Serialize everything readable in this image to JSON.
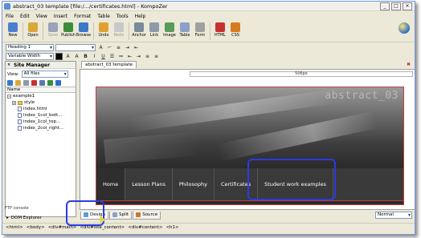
{
  "window": {
    "title": "abstract_03 template [file:/.../certificates.html] - KompoZer"
  },
  "menu": [
    "File",
    "Edit",
    "View",
    "Insert",
    "Format",
    "Table",
    "Tools",
    "Help"
  ],
  "toolbar": {
    "buttons": [
      {
        "label": "New",
        "icon": "new-icon",
        "color": "#4a7fd0"
      },
      {
        "label": "Open",
        "icon": "open-icon",
        "color": "#d8a93a"
      },
      {
        "label": "Save",
        "icon": "save-icon",
        "color": "#9aa3b8"
      },
      {
        "label": "Publish",
        "icon": "publish-icon",
        "color": "#3c8c3c"
      },
      {
        "label": "Browse",
        "icon": "browse-icon",
        "color": "#3a7ac8"
      },
      {
        "label": "Undo",
        "icon": "undo-icon",
        "color": "#e0a030"
      },
      {
        "label": "Redo",
        "icon": "redo-icon",
        "color": "#c8c8c8"
      },
      {
        "label": "Anchor",
        "icon": "anchor-icon",
        "color": "#7a8a98"
      },
      {
        "label": "Link",
        "icon": "link-icon",
        "color": "#8a9aa8"
      },
      {
        "label": "Image",
        "icon": "image-icon",
        "color": "#5a9a5a"
      },
      {
        "label": "Table",
        "icon": "table-icon",
        "color": "#8aa0c8"
      },
      {
        "label": "Form",
        "icon": "form-icon",
        "color": "#a0a0a0"
      },
      {
        "label": "HTML",
        "icon": "html-icon",
        "color": "#c83030"
      },
      {
        "label": "CSS",
        "icon": "css-icon",
        "color": "#d87a20"
      }
    ]
  },
  "format": {
    "paragraph_style": "Heading 1",
    "width_style": "Variable Width",
    "bold": "B",
    "italic": "I",
    "underline": "U"
  },
  "site_manager": {
    "title": "Site Manager",
    "view_label": "View:",
    "view_value": "All files",
    "column_name": "Name",
    "tree": [
      {
        "label": "example1",
        "type": "root"
      },
      {
        "label": "style",
        "type": "folder"
      },
      {
        "label": "index.html",
        "type": "file"
      },
      {
        "label": "index_1col_bott...",
        "type": "file"
      },
      {
        "label": "index_1col_top...",
        "type": "file"
      },
      {
        "label": "index_2col_right...",
        "type": "file"
      }
    ],
    "ftp_console": "FTP console",
    "dom_explorer": "DOM Explorer"
  },
  "editor": {
    "tab_title": "abstract_03 template",
    "ruler_text": "506px",
    "banner_title": "abstract_03",
    "nav_items": [
      "Home",
      "Lesson Plans",
      "Philosophy",
      "Certificates",
      "Student work examples"
    ]
  },
  "mode_tabs": [
    "Design",
    "Split",
    "Source"
  ],
  "mode_select": "Normal",
  "status_path": [
    "<html>",
    "<body>",
    "<div#main>",
    "<div#site_content>",
    "<div#content>",
    "<h1>"
  ],
  "colors": {
    "highlight": "#2b3be0",
    "nav_bg": "#3a3a3a",
    "page_border": "#c04040"
  }
}
